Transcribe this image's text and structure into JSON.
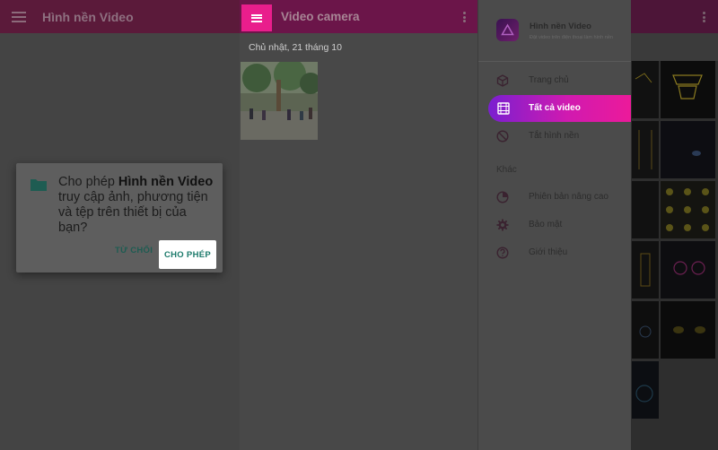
{
  "left_panel": {
    "title": "Hình nền Video",
    "dialog": {
      "text_prefix": "Cho phép ",
      "app_name": "Hình nền Video",
      "text_suffix": " truy cập ảnh, phương tiện và tệp trên thiết bị của bạn?",
      "deny_label": "TỪ CHỐI",
      "allow_label": "CHO PHÉP"
    }
  },
  "middle_panel": {
    "title": "Video camera",
    "date_header": "Chủ nhật, 21 tháng 10"
  },
  "drawer": {
    "app_name": "Hình nền Video",
    "app_subtitle": "Đặt video trên điện thoại làm hình nền",
    "items": [
      {
        "label": "Trang chủ",
        "icon": "cube-icon"
      },
      {
        "label": "Tất cả video",
        "icon": "film-icon",
        "active": true
      },
      {
        "label": "Tắt hình nền",
        "icon": "block-icon"
      }
    ],
    "section_label": "Khác",
    "other_items": [
      {
        "label": "Phiên bản nâng cao",
        "icon": "pie-icon"
      },
      {
        "label": "Bảo mật",
        "icon": "gear-icon"
      },
      {
        "label": "Giới thiệu",
        "icon": "help-icon"
      }
    ]
  },
  "colors": {
    "accent_pink": "#e91e8c",
    "gradient_start": "#7a1fd0",
    "gradient_end": "#ec1a9a",
    "allow_text": "#1c7a6b"
  }
}
